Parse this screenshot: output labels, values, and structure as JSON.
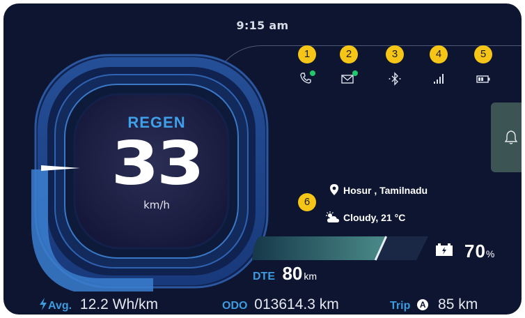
{
  "clock": "9:15 am",
  "status_icons": [
    {
      "badge": "1",
      "icon": "phone-icon",
      "indicator": "green"
    },
    {
      "badge": "2",
      "icon": "mail-icon",
      "indicator": "green"
    },
    {
      "badge": "3",
      "icon": "bluetooth-icon"
    },
    {
      "badge": "4",
      "icon": "signal-icon"
    },
    {
      "badge": "5",
      "icon": "battery-status-icon"
    }
  ],
  "notification": {
    "icon": "bell-icon"
  },
  "speedometer": {
    "mode": "REGEN",
    "speed": "33",
    "unit": "km/h"
  },
  "info": {
    "badge": "6",
    "location": "Hosur , Tamilnadu",
    "weather": "Cloudy, 21 °C"
  },
  "battery": {
    "percent_value": "70",
    "percent_sign": "%",
    "level": 0.7
  },
  "dte": {
    "label": "DTE",
    "value": "80",
    "unit": "km"
  },
  "bottom_bar": {
    "avg_label": "Avg.",
    "avg_value": "12.2 Wh/km",
    "odo_label": "ODO",
    "odo_value": "013614.3 km",
    "trip_label": "Trip",
    "trip_mode": "A",
    "trip_value": "85 km"
  },
  "colors": {
    "accent": "#3d9be0",
    "badge": "#f5c518",
    "background": "#0d1530",
    "indicator": "#1fc86a"
  }
}
